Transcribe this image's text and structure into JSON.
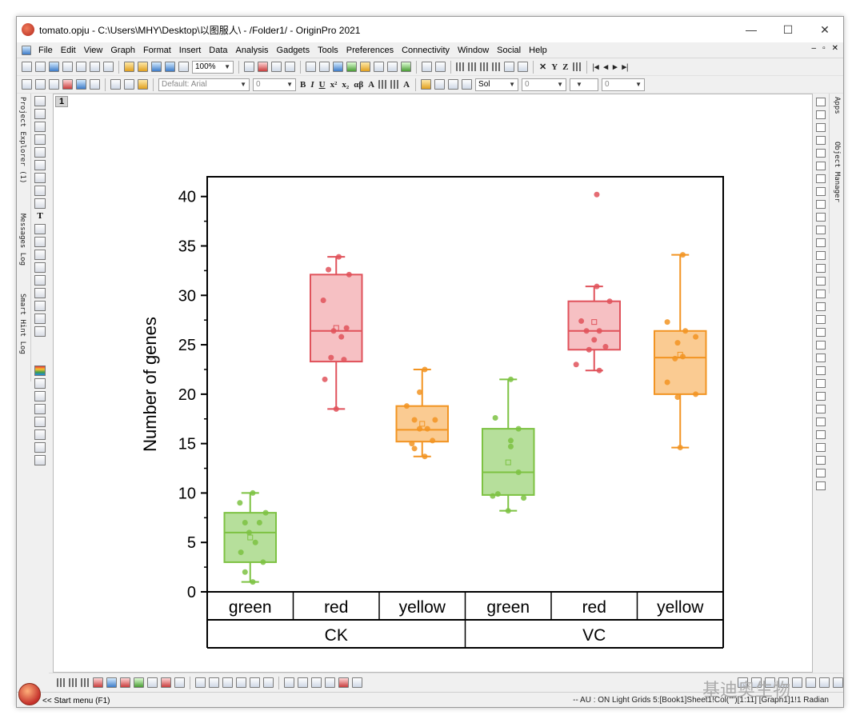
{
  "window": {
    "title": "tomato.opju - C:\\Users\\MHY\\Desktop\\以图服人\\ - /Folder1/ - OriginPro 2021",
    "minimize": "—",
    "maximize": "☐",
    "close": "✕"
  },
  "menu": [
    "File",
    "Edit",
    "View",
    "Graph",
    "Format",
    "Insert",
    "Data",
    "Analysis",
    "Gadgets",
    "Tools",
    "Preferences",
    "Connectivity",
    "Window",
    "Social",
    "Help"
  ],
  "mdi_controls": [
    "–",
    "▫",
    "✕"
  ],
  "toolbar": {
    "zoom": "100%",
    "font": "Default: Arial",
    "font_size": "0",
    "line_style": "Sol",
    "line_width": "0",
    "fill_value": "0"
  },
  "left_tabs": [
    "Project Explorer (1)",
    "Messages Log",
    "Smart Hint Log"
  ],
  "right_tabs": [
    "Apps",
    "Object Manager"
  ],
  "graph": {
    "layer_label": "1"
  },
  "chart_data": {
    "type": "box",
    "ylabel": "Number of genes",
    "ylim": [
      0,
      42
    ],
    "yticks": [
      0,
      5,
      10,
      15,
      20,
      25,
      30,
      35,
      40
    ],
    "groups": [
      "CK",
      "VC"
    ],
    "categories": [
      "green",
      "red",
      "yellow",
      "green",
      "red",
      "yellow"
    ],
    "boxes": [
      {
        "group": "CK",
        "category": "green",
        "color": "#7dc242",
        "fill": "#a9d98a",
        "min": 1,
        "q1": 3,
        "median": 6,
        "mean": 5.5,
        "q3": 8,
        "max": 10,
        "points": [
          [
            -0.2,
            9
          ],
          [
            0.05,
            10
          ],
          [
            0.3,
            8
          ],
          [
            -0.1,
            7
          ],
          [
            0.18,
            7
          ],
          [
            -0.02,
            6
          ],
          [
            0.1,
            5
          ],
          [
            -0.18,
            4
          ],
          [
            0.25,
            3
          ],
          [
            -0.1,
            2
          ],
          [
            0.05,
            1
          ]
        ]
      },
      {
        "group": "CK",
        "category": "red",
        "color": "#e0525b",
        "fill": "#f5b5b9",
        "min": 18.5,
        "q1": 23.3,
        "median": 26.4,
        "mean": 26.7,
        "q3": 32.1,
        "max": 33.9,
        "points": [
          [
            -0.15,
            32.6
          ],
          [
            0.05,
            33.9
          ],
          [
            0.25,
            32.1
          ],
          [
            -0.25,
            29.5
          ],
          [
            -0.05,
            26.4
          ],
          [
            0.2,
            26.7
          ],
          [
            0.1,
            25.8
          ],
          [
            -0.1,
            23.7
          ],
          [
            0.15,
            23.5
          ],
          [
            -0.22,
            21.5
          ],
          [
            0.0,
            18.5
          ]
        ]
      },
      {
        "group": "CK",
        "category": "yellow",
        "color": "#f29422",
        "fill": "#f9c27f",
        "min": 13.7,
        "q1": 15.2,
        "median": 16.4,
        "mean": 17.0,
        "q3": 18.8,
        "max": 22.5,
        "points": [
          [
            0.05,
            22.5
          ],
          [
            -0.05,
            20.2
          ],
          [
            -0.3,
            18.8
          ],
          [
            -0.15,
            17.4
          ],
          [
            0.25,
            17.4
          ],
          [
            -0.05,
            16.5
          ],
          [
            0.1,
            16.5
          ],
          [
            0.2,
            15.3
          ],
          [
            -0.2,
            15.0
          ],
          [
            -0.15,
            14.5
          ],
          [
            0.05,
            13.7
          ]
        ]
      },
      {
        "group": "VC",
        "category": "green",
        "color": "#7dc242",
        "fill": "#a9d98a",
        "min": 8.2,
        "q1": 9.8,
        "median": 12.1,
        "mean": 13.1,
        "q3": 16.5,
        "max": 21.5,
        "points": [
          [
            0.05,
            21.5
          ],
          [
            -0.25,
            17.6
          ],
          [
            0.2,
            16.5
          ],
          [
            0.05,
            15.3
          ],
          [
            0.05,
            14.7
          ],
          [
            0.2,
            12.1
          ],
          [
            -0.2,
            9.9
          ],
          [
            -0.3,
            9.7
          ],
          [
            0.3,
            9.5
          ],
          [
            0.0,
            8.2
          ]
        ]
      },
      {
        "group": "VC",
        "category": "red",
        "color": "#e0525b",
        "fill": "#f5b5b9",
        "min": 22.4,
        "q1": 24.5,
        "median": 26.4,
        "mean": 27.3,
        "q3": 29.4,
        "max": 30.9,
        "points": [
          [
            0.05,
            40.2
          ],
          [
            0.05,
            30.9
          ],
          [
            0.3,
            29.4
          ],
          [
            -0.25,
            27.4
          ],
          [
            -0.15,
            26.4
          ],
          [
            0.1,
            26.4
          ],
          [
            0.0,
            25.5
          ],
          [
            0.22,
            24.8
          ],
          [
            -0.1,
            24.5
          ],
          [
            -0.35,
            23.0
          ],
          [
            0.1,
            22.4
          ]
        ]
      },
      {
        "group": "VC",
        "category": "yellow",
        "color": "#f29422",
        "fill": "#f9c27f",
        "min": 14.6,
        "q1": 20.0,
        "median": 23.7,
        "mean": 24.0,
        "q3": 26.4,
        "max": 34.1,
        "points": [
          [
            0.05,
            34.1
          ],
          [
            -0.25,
            27.3
          ],
          [
            0.1,
            26.4
          ],
          [
            0.3,
            25.8
          ],
          [
            -0.05,
            25.2
          ],
          [
            0.05,
            23.8
          ],
          [
            -0.1,
            23.6
          ],
          [
            -0.25,
            21.2
          ],
          [
            0.3,
            20.0
          ],
          [
            -0.05,
            19.7
          ],
          [
            0.0,
            14.6
          ]
        ]
      }
    ],
    "mean_marker": "hollow-square",
    "grid": false
  },
  "status": {
    "start_menu": "<< Start menu (F1)",
    "right": "--   AU : ON  Light Grids  5:[Book1]Sheet1!Col(\"\")[1:11]  [Graph1]1!1 Radian"
  },
  "watermark": "基迪奥生物"
}
